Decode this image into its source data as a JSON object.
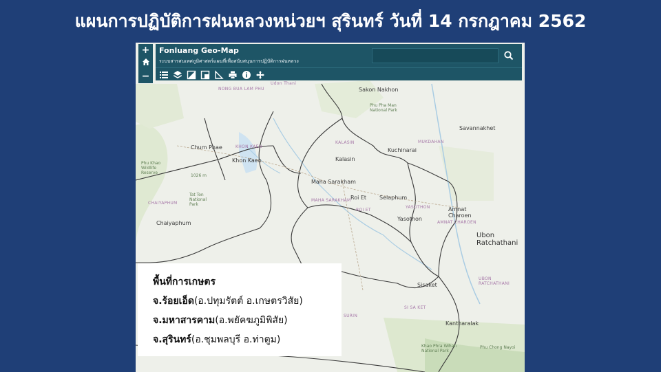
{
  "slide": {
    "title": "แผนการปฏิบัติการฝนหลวงหน่วยฯ สุรินทร์ วันที่ 14 กรกฎาคม 2562"
  },
  "app": {
    "title": "Fonluang Geo-Map",
    "subtitle": "ระบบสารสนเทศภูมิศาสตร์แผนที่เพื่อสนับสนุนการปฏิบัติการฝนหลวง",
    "search_placeholder": "",
    "zoom_in": "+",
    "zoom_out": "−",
    "header_color": "#1e5566"
  },
  "toolbar": {
    "tools": [
      "list-icon",
      "layers-icon",
      "basemap-icon",
      "measure-icon",
      "print-icon",
      "info-icon",
      "pan-icon"
    ]
  },
  "map": {
    "labels": {
      "sakon_nakhon": "Sakon Nakhon",
      "chum_phae": "Chum Phae",
      "khon_kaen_region": "KHON KAEN",
      "khon_kaen": "Khon Kaen",
      "kalasin_region": "KALASIN",
      "kalasin": "Kalasin",
      "kuchinarai": "Kuchinarai",
      "mukdahan_region": "MUKDAHAN",
      "savannakhet": "Savannakhet",
      "maha_sarakham": "Maha Sarakham",
      "maha_sarakham_region": "MAHA SARAKHAM",
      "roi_et": "Roi Et",
      "roi_et_region": "ROI ET",
      "selaphum": "Selaphum",
      "yasothon_region": "YASOTHON",
      "yasothon": "Yasothon",
      "amnat_charoen": "Amnat Charoen",
      "amnat_charoen_region": "AMNAT CHAROEN",
      "chaiyaphum_region": "CHAIYAPHUM",
      "chaiyaphum": "Chaiyaphum",
      "ubon": "Ubon Ratchathani",
      "ubon_region": "UBON RATCHATHANI",
      "sisaket": "Sisaket",
      "si_sa_ket_region": "SI SA KET",
      "surin_region": "SURIN",
      "kantharalak": "Kantharalak",
      "nong_bua": "NONG BUA LAM PHU",
      "phu_pha_man": "Phu Pha Man National Park",
      "khao_phra_wihan": "Khao Phra Wihan National Park",
      "phu_chong": "Phu Chong Nayoi",
      "tat_ton": "Tat Ton National Park",
      "elev": "1026 m",
      "phu_khao": "Phu Khao Wildlife Reserve",
      "udon_thani": "Udon Thani"
    }
  },
  "legend": {
    "heading": "พื้นที่การเกษตร",
    "items": [
      {
        "province": "จ.ร้อยเอ็ด",
        "districts": "(อ.ปทุมรัตต์ อ.เกษตรวิสัย)"
      },
      {
        "province": "จ.มหาสารคาม",
        "districts": "(อ.พยัคฆภูมิพิสัย)"
      },
      {
        "province": "จ.สุรินทร์",
        "districts": "(อ.ชุมพลบุรี อ.ท่าตูม)"
      }
    ]
  }
}
